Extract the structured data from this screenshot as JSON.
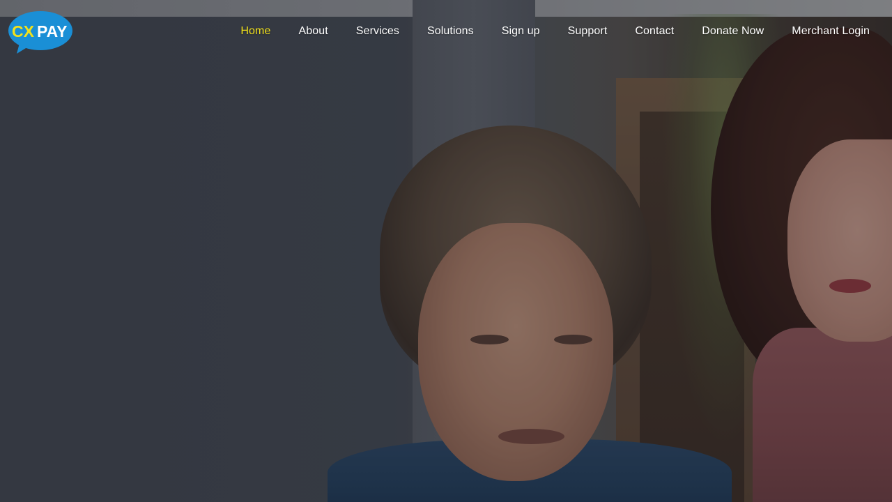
{
  "brand": {
    "logo_text_cx": "CX",
    "logo_text_pay": "PAY",
    "logo_bubble_color": "#1a8fd6",
    "logo_cx_color": "#f2e11b",
    "logo_pay_color": "#ffffff"
  },
  "nav": {
    "active_color": "#f2e11b",
    "items": [
      {
        "label": "Home",
        "active": true
      },
      {
        "label": "About",
        "active": false
      },
      {
        "label": "Services",
        "active": false
      },
      {
        "label": "Solutions",
        "active": false
      },
      {
        "label": "Sign up",
        "active": false
      },
      {
        "label": "Support",
        "active": false
      },
      {
        "label": "Contact",
        "active": false
      },
      {
        "label": "Donate Now",
        "active": false
      },
      {
        "label": "Merchant Login",
        "active": false
      }
    ]
  }
}
